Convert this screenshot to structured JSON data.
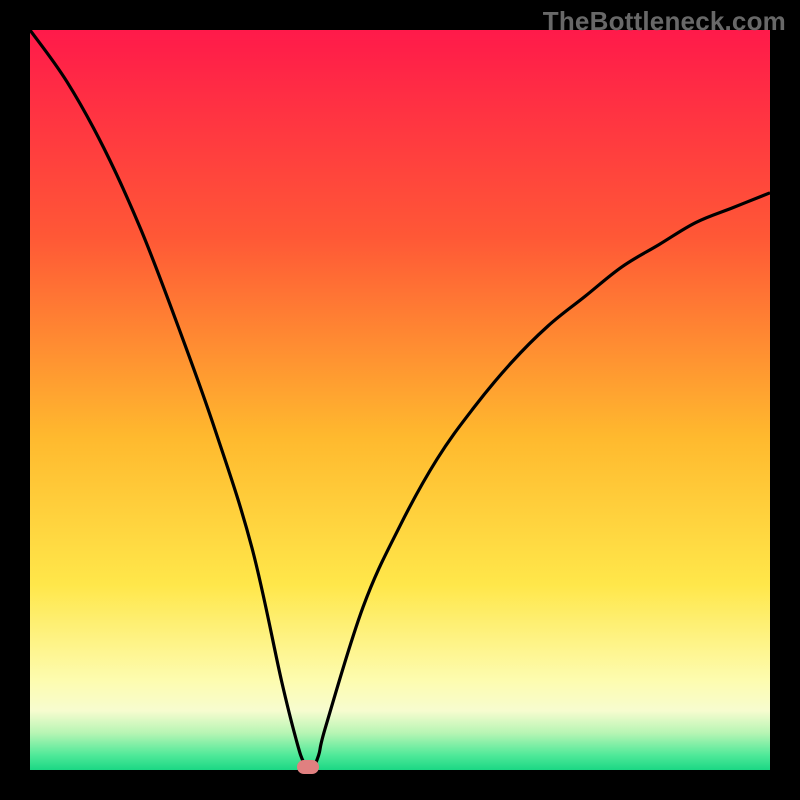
{
  "watermark": "TheBottleneck.com",
  "chart_data": {
    "type": "line",
    "title": "",
    "xlabel": "",
    "ylabel": "",
    "xlim": [
      0,
      100
    ],
    "ylim": [
      0,
      100
    ],
    "grid": false,
    "series": [
      {
        "name": "bottleneck-curve",
        "x": [
          0,
          5,
          10,
          15,
          20,
          25,
          30,
          34,
          36,
          37,
          38,
          39,
          40,
          45,
          50,
          55,
          60,
          65,
          70,
          75,
          80,
          85,
          90,
          95,
          100
        ],
        "values": [
          100,
          93,
          84,
          73,
          60,
          46,
          30,
          12,
          4,
          1,
          0,
          2,
          6,
          22,
          33,
          42,
          49,
          55,
          60,
          64,
          68,
          71,
          74,
          76,
          78
        ]
      }
    ],
    "marker": {
      "x": 37.5,
      "y": 0
    },
    "gradient_stops": [
      {
        "offset": 0,
        "color": "#ff1a4a"
      },
      {
        "offset": 28,
        "color": "#ff5836"
      },
      {
        "offset": 55,
        "color": "#ffb92e"
      },
      {
        "offset": 75,
        "color": "#ffe74a"
      },
      {
        "offset": 88,
        "color": "#fdfcb0"
      },
      {
        "offset": 92,
        "color": "#f7fccf"
      },
      {
        "offset": 95,
        "color": "#b7f5b4"
      },
      {
        "offset": 98,
        "color": "#4fe999"
      },
      {
        "offset": 100,
        "color": "#1bd784"
      }
    ]
  }
}
